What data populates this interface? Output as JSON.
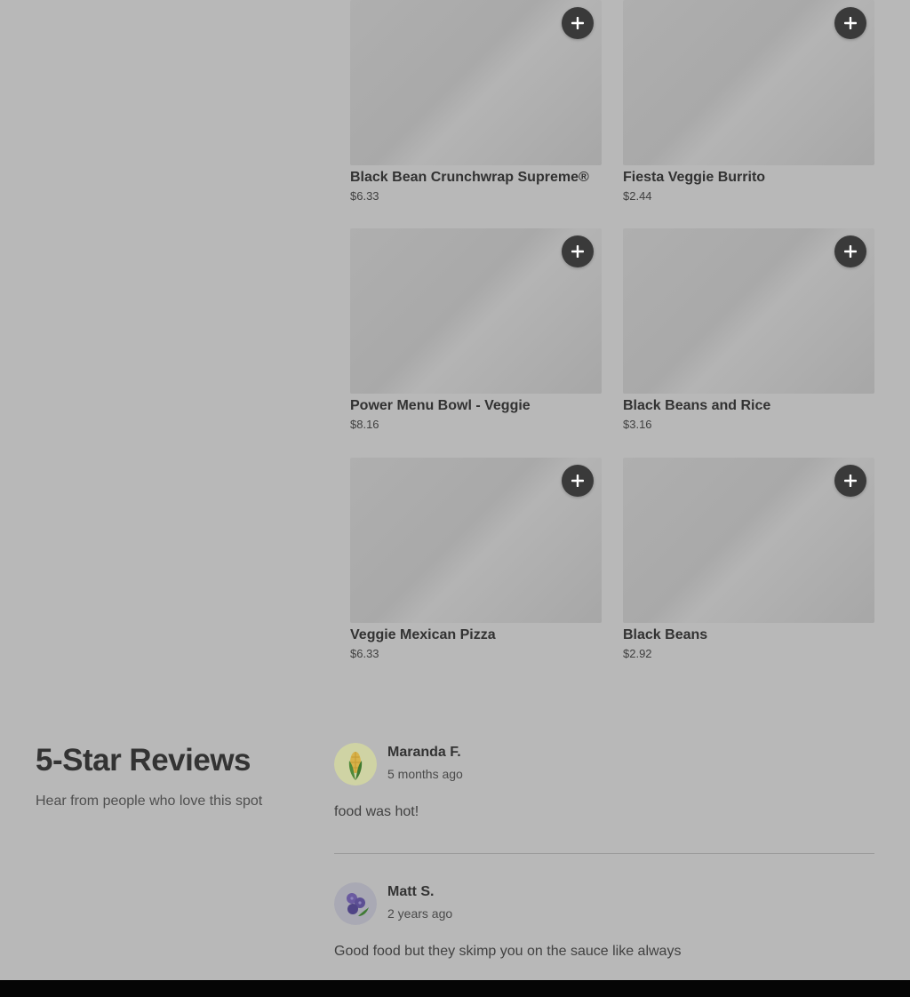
{
  "menu": {
    "items": [
      {
        "name": "Black Bean Crunchwrap Supreme®",
        "price": "$6.33"
      },
      {
        "name": "Fiesta Veggie Burrito",
        "price": "$2.44"
      },
      {
        "name": "Power Menu Bowl - Veggie",
        "price": "$8.16"
      },
      {
        "name": "Black Beans and Rice",
        "price": "$3.16"
      },
      {
        "name": "Veggie Mexican Pizza",
        "price": "$6.33"
      },
      {
        "name": "Black Beans",
        "price": "$2.92"
      }
    ],
    "add_icon": "plus-icon"
  },
  "reviews": {
    "title": "5-Star Reviews",
    "subtitle": "Hear from people who love this spot",
    "list": [
      {
        "name": "Maranda F.",
        "when": "5 months ago",
        "text": "food was hot!",
        "avatar_icon": "corn-icon"
      },
      {
        "name": "Matt S.",
        "when": "2 years ago",
        "text": "Good food but they skimp you on the sauce like always",
        "avatar_icon": "blueberry-icon"
      }
    ]
  },
  "colors": {
    "overlay_background": "#b8b8b8",
    "add_button": "#3a3a3a",
    "bottom_bar": "#050505"
  }
}
